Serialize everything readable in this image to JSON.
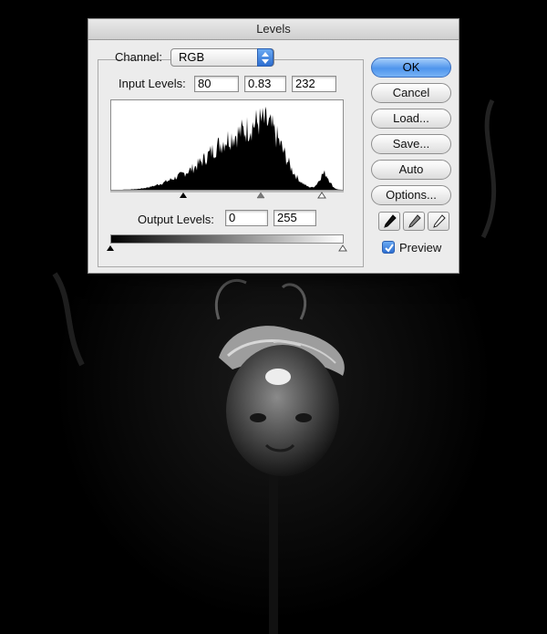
{
  "dialog": {
    "title": "Levels",
    "channel_label": "Channel:",
    "channel_value": "RGB",
    "input_levels_label": "Input Levels:",
    "input_black": "80",
    "input_gamma": "0.83",
    "input_white": "232",
    "output_levels_label": "Output Levels:",
    "output_black": "0",
    "output_white": "255",
    "preview_label": "Preview",
    "preview_checked": true
  },
  "buttons": {
    "ok": "OK",
    "cancel": "Cancel",
    "load": "Load...",
    "save": "Save...",
    "auto": "Auto",
    "options": "Options..."
  },
  "icons": {
    "black_point": "black-eyedropper-icon",
    "gray_point": "gray-eyedropper-icon",
    "white_point": "white-eyedropper-icon"
  },
  "colors": {
    "accent": "#4f95ec",
    "dialog_bg": "#ececec"
  }
}
